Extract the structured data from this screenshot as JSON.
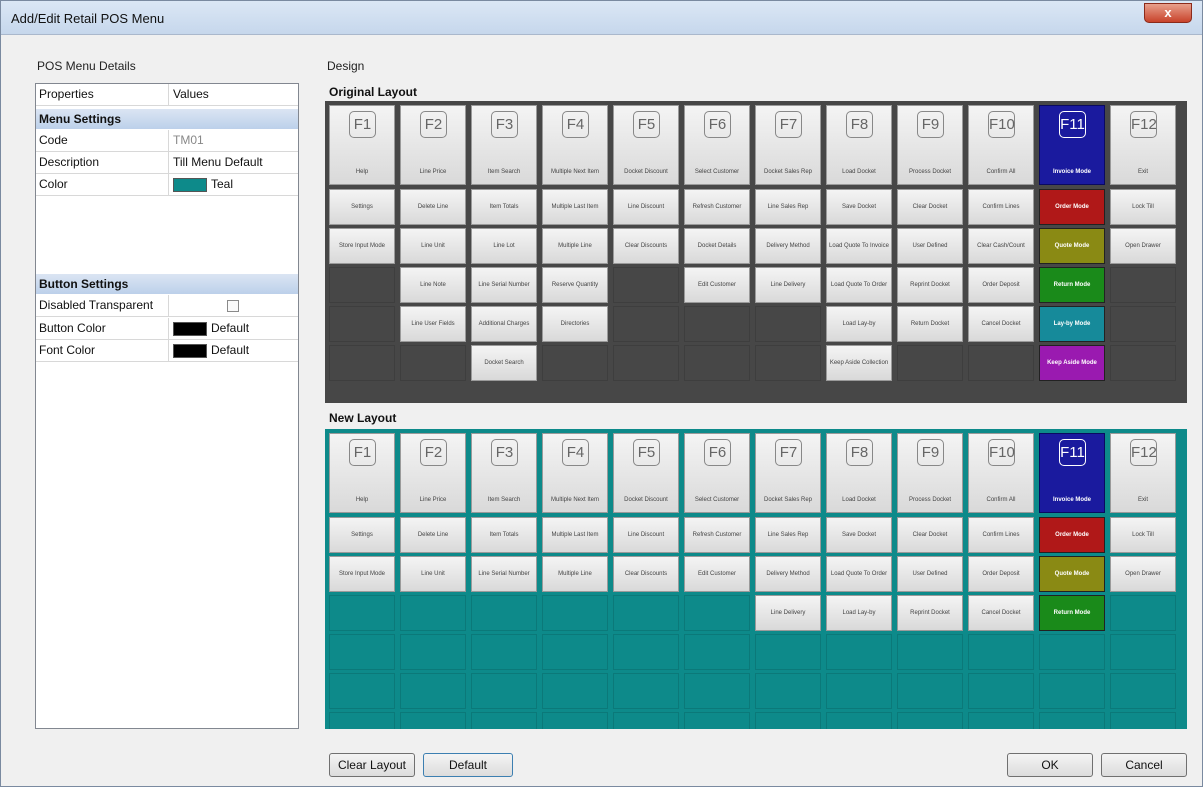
{
  "window": {
    "title": "Add/Edit Retail POS Menu",
    "close": "x"
  },
  "left": {
    "header": "POS Menu Details",
    "columns": {
      "properties": "Properties",
      "values": "Values"
    },
    "menu_settings": {
      "label": "Menu Settings",
      "rows": [
        {
          "name": "Code",
          "value": "TM01"
        },
        {
          "name": "Description",
          "value": "Till Menu Default"
        },
        {
          "name": "Color",
          "value": "Teal",
          "swatch": "#0d8a8a"
        }
      ]
    },
    "button_settings": {
      "label": "Button Settings",
      "rows": [
        {
          "name": "Disabled Transparent",
          "value": ""
        },
        {
          "name": "Button Color",
          "value": "Default",
          "swatch": "#000000"
        },
        {
          "name": "Font Color",
          "value": "Default",
          "swatch": "#000000"
        }
      ]
    }
  },
  "design": {
    "label": "Design",
    "original_title": "Original Layout",
    "new_title": "New Layout",
    "colors": {
      "original_bg": "#474747",
      "new_bg": "#0d8a8a",
      "f11": "#1a1a9e",
      "order": "#b01818",
      "quote": "#8a8a14",
      "return": "#1a8a1a",
      "layby": "#168a9a",
      "keep": "#9a1ab0"
    },
    "original_columns": [
      [
        "F1|Help",
        "Settings",
        "Store Input Mode"
      ],
      [
        "F2|Line Price",
        "Delete Line",
        "Line Unit",
        "Line Note",
        "Line User Fields"
      ],
      [
        "F3|Item Search",
        "Item Totals",
        "Line Lot",
        "Line Serial Number",
        "Additional Charges",
        "Docket Search"
      ],
      [
        "F4|Multiple Next Item",
        "Multiple Last Item",
        "Multiple Line",
        "Reserve Quantity",
        "Directories"
      ],
      [
        "F5|Docket Discount",
        "Line Discount",
        "Clear Discounts"
      ],
      [
        "F6|Select Customer",
        "Refresh Customer",
        "Docket Details",
        "Edit Customer"
      ],
      [
        "F7|Docket Sales Rep",
        "Line Sales Rep",
        "Delivery Method",
        "Line Delivery"
      ],
      [
        "F8|Load Docket",
        "Save Docket",
        "Load Quote To Invoice",
        "Load Quote To Order",
        "Load Lay-by",
        "Keep Aside Collection"
      ],
      [
        "F9|Process Docket",
        "Clear Docket",
        "User Defined",
        "Reprint Docket",
        "Return Docket"
      ],
      [
        "F10|Confirm All",
        "Confirm Lines",
        "Clear Cash/Count",
        "Order Deposit",
        "Cancel Docket"
      ],
      [
        "F11|Invoice Mode",
        "Order Mode",
        "Quote Mode",
        "Return Mode",
        "Lay-by Mode",
        "Keep Aside Mode"
      ],
      [
        "F12|Exit",
        "Lock Till",
        "Open Drawer"
      ]
    ],
    "new_columns": [
      [
        "F1|Help",
        "Settings",
        "Store Input Mode"
      ],
      [
        "F2|Line Price",
        "Delete Line",
        "Line Unit"
      ],
      [
        "F3|Item Search",
        "Item Totals",
        "Line Serial Number"
      ],
      [
        "F4|Multiple Next Item",
        "Multiple Last Item",
        "Multiple Line"
      ],
      [
        "F5|Docket Discount",
        "Line Discount",
        "Clear Discounts"
      ],
      [
        "F6|Select Customer",
        "Refresh Customer",
        "Edit Customer"
      ],
      [
        "F7|Docket Sales Rep",
        "Line Sales Rep",
        "Delivery Method",
        "Line Delivery"
      ],
      [
        "F8|Load Docket",
        "Save Docket",
        "Load Quote To Order",
        "Load Lay-by"
      ],
      [
        "F9|Process Docket",
        "Clear Docket",
        "User Defined",
        "Reprint Docket"
      ],
      [
        "F10|Confirm All",
        "Confirm Lines",
        "Order Deposit",
        "Cancel Docket"
      ],
      [
        "F11|Invoice Mode",
        "Order Mode",
        "Quote Mode",
        "Return Mode"
      ],
      [
        "F12|Exit",
        "Lock Till",
        "Open Drawer"
      ]
    ]
  },
  "footer": {
    "clear_layout": "Clear Layout",
    "default": "Default",
    "ok": "OK",
    "cancel": "Cancel"
  }
}
